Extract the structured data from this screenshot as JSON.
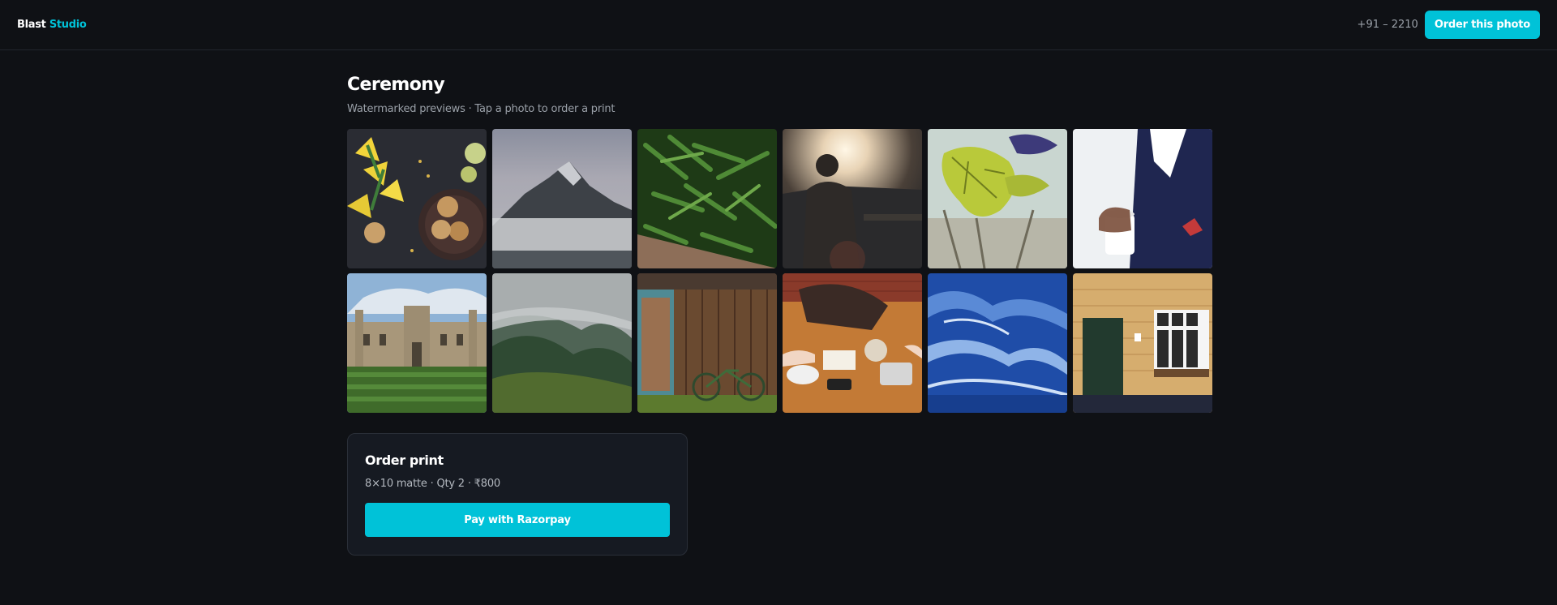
{
  "header": {
    "brand_primary": "Blast",
    "brand_accent": "Studio",
    "phone": "+91 – 2210",
    "order_button": "Order this photo"
  },
  "gallery": {
    "title": "Ceremony",
    "subtitle": "Watermarked previews · Tap a photo to order a print"
  },
  "photos": [
    {
      "icon": "flowers-cookies-photo"
    },
    {
      "icon": "misty-mountain-photo"
    },
    {
      "icon": "green-beans-photo"
    },
    {
      "icon": "sunset-silhouette-photo"
    },
    {
      "icon": "green-leaf-photo"
    },
    {
      "icon": "suit-coffee-cup-photo"
    },
    {
      "icon": "college-building-photo"
    },
    {
      "icon": "foggy-forest-hill-photo"
    },
    {
      "icon": "wooden-shed-bicycle-photo"
    },
    {
      "icon": "cafe-table-phone-photo"
    },
    {
      "icon": "ocean-waves-photo"
    },
    {
      "icon": "brick-house-door-photo"
    }
  ],
  "order": {
    "title": "Order print",
    "detail": "8×10 matte · Qty 2 · ₹800",
    "pay_button": "Pay with Razorpay"
  },
  "colors": {
    "background": "#0f1115",
    "accent": "#00c2d8",
    "card": "#161a22"
  }
}
